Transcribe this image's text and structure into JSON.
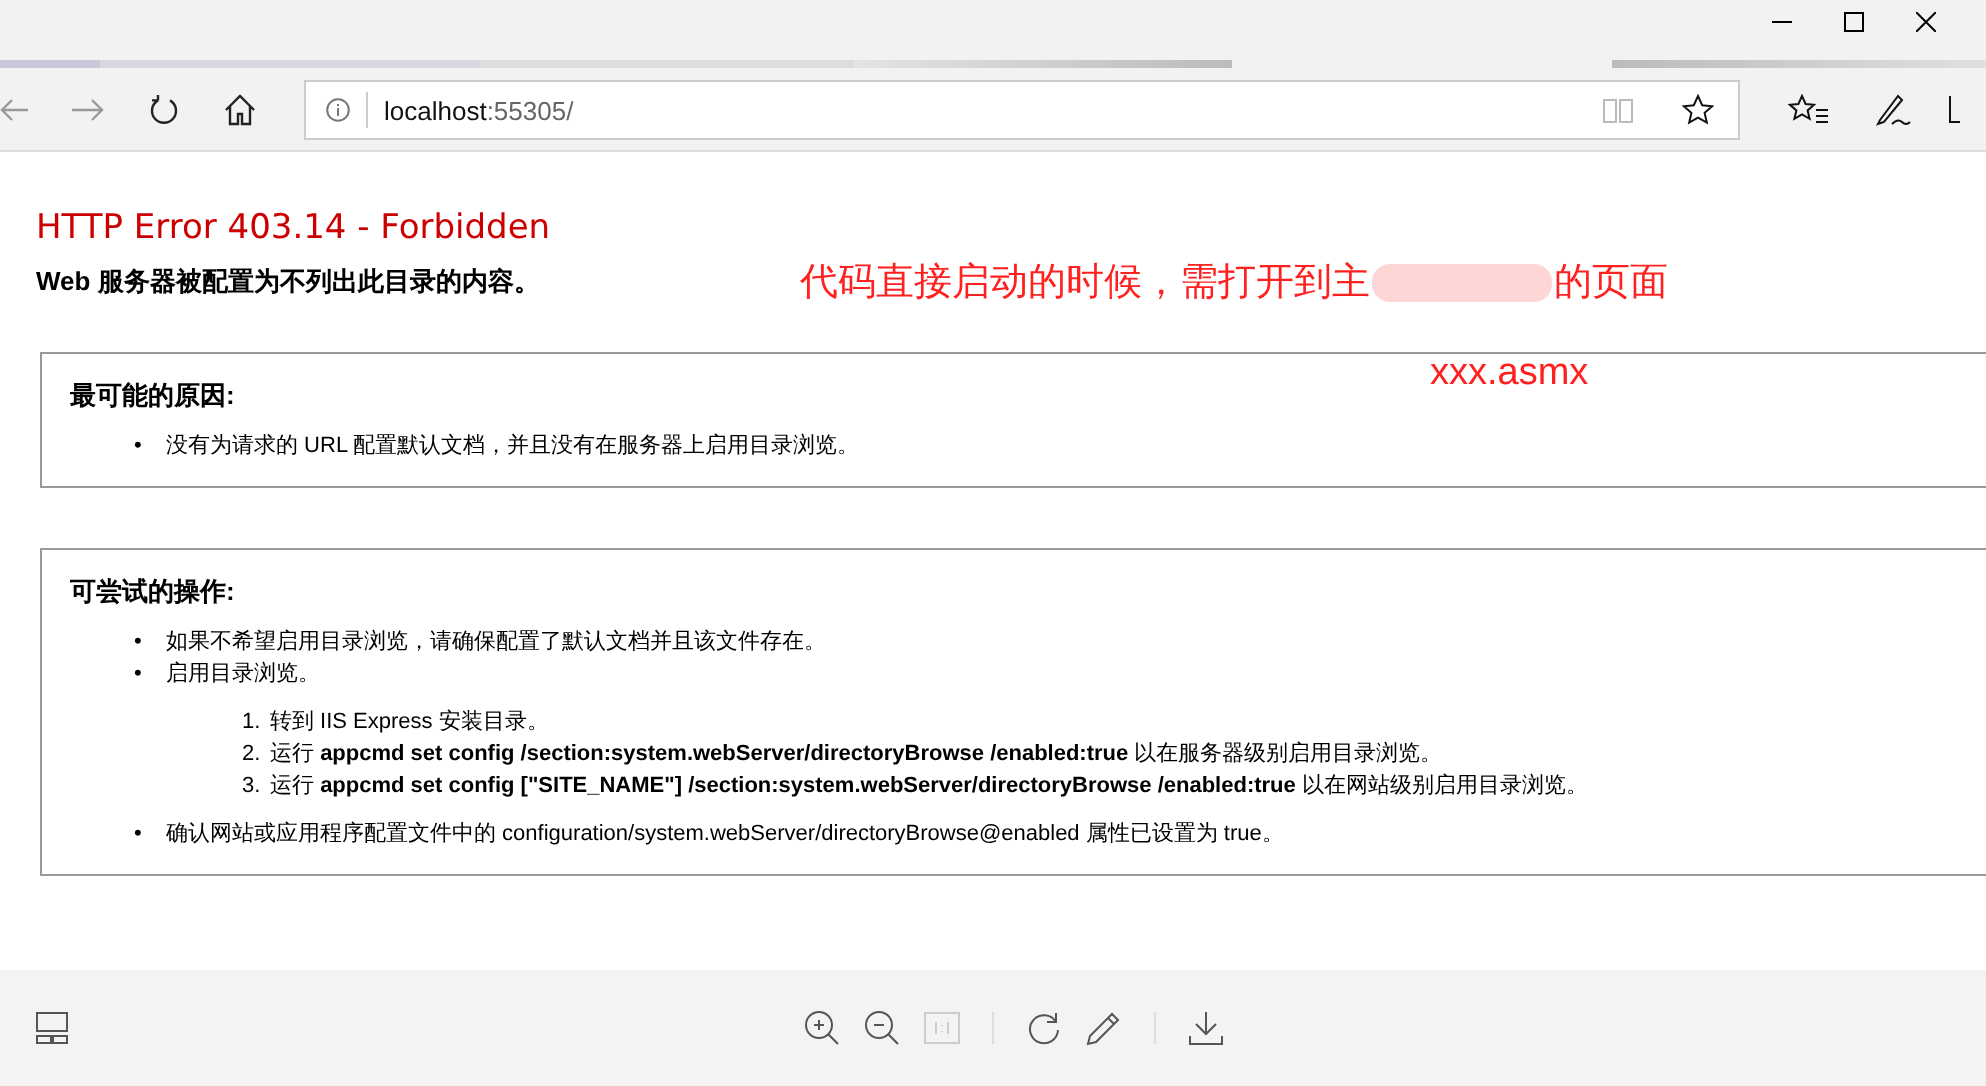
{
  "browser": {
    "address": {
      "host": "localhost",
      "rest": ":55305/"
    }
  },
  "page": {
    "title": "HTTP Error 403.14 - Forbidden",
    "subtitle": "Web 服务器被配置为不列出此目录的内容。",
    "sections": [
      {
        "heading": "最可能的原因:",
        "items": [
          {
            "marker": "•",
            "text": "没有为请求的 URL 配置默认文档，并且没有在服务器上启用目录浏览。"
          }
        ]
      },
      {
        "heading": "可尝试的操作:",
        "items": [
          {
            "marker": "•",
            "text": "如果不希望启用目录浏览，请确保配置了默认文档并且该文件存在。"
          },
          {
            "marker": "•",
            "text": "启用目录浏览。",
            "steps": [
              {
                "number": "1.",
                "text": "转到 IIS Express 安装目录。"
              },
              {
                "number": "2.",
                "text": "运行 **appcmd set config /section:system.webServer/directoryBrowse /enabled:true** 以在服务器级别启用目录浏览。"
              },
              {
                "number": "3.",
                "text": "运行 **appcmd set config [\"SITE_NAME\"] /section:system.webServer/directoryBrowse /enabled:true** 以在网站级别启用目录浏览。"
              }
            ]
          },
          {
            "marker": "•",
            "text": "确认网站或应用程序配置文件中的 configuration/system.webServer/directoryBrowse@enabled 属性已设置为 true。"
          }
        ]
      }
    ]
  },
  "annotation": {
    "before": "代码直接启动的时候，需打开到主",
    "after": "的页面",
    "file": "xxx.asmx"
  }
}
